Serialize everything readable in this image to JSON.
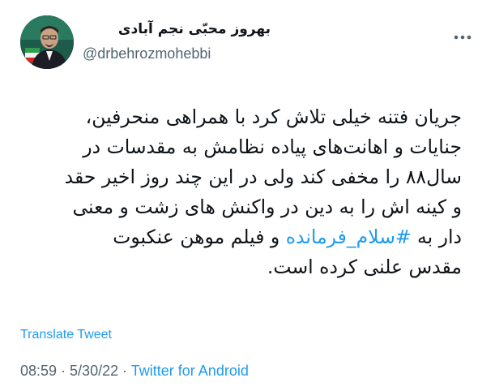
{
  "author": {
    "display_name": "بهروز محبّی نجم آبادی",
    "handle": "@drbehrozmohebbi"
  },
  "tweet": {
    "lines": [
      "جریان فتنه خیلی تلاش کرد با همراهی منحرفین،",
      "جنایات و اهانت‌های پیاده نظامش به مقدسات در",
      "سال۸۸ را مخفی کند ولی در این چند روز اخیر حقد",
      "و کینه اش را به دین در واکنش های زشت و معنی"
    ],
    "line5_before": "دار به ",
    "hashtag": "#سلام_فرمانده",
    "line5_after": " و فیلم موهن عنکبوت",
    "line6": "مقدس علنی کرده است."
  },
  "translate_label": "Translate Tweet",
  "meta": {
    "time": "08:59",
    "separator": " · ",
    "date": "5/30/22",
    "source": "Twitter for Android"
  },
  "colors": {
    "text": "#0f1419",
    "secondary": "#536471",
    "link": "#1d9bf0"
  },
  "icons": {
    "more": "more-horizontal-icon"
  }
}
